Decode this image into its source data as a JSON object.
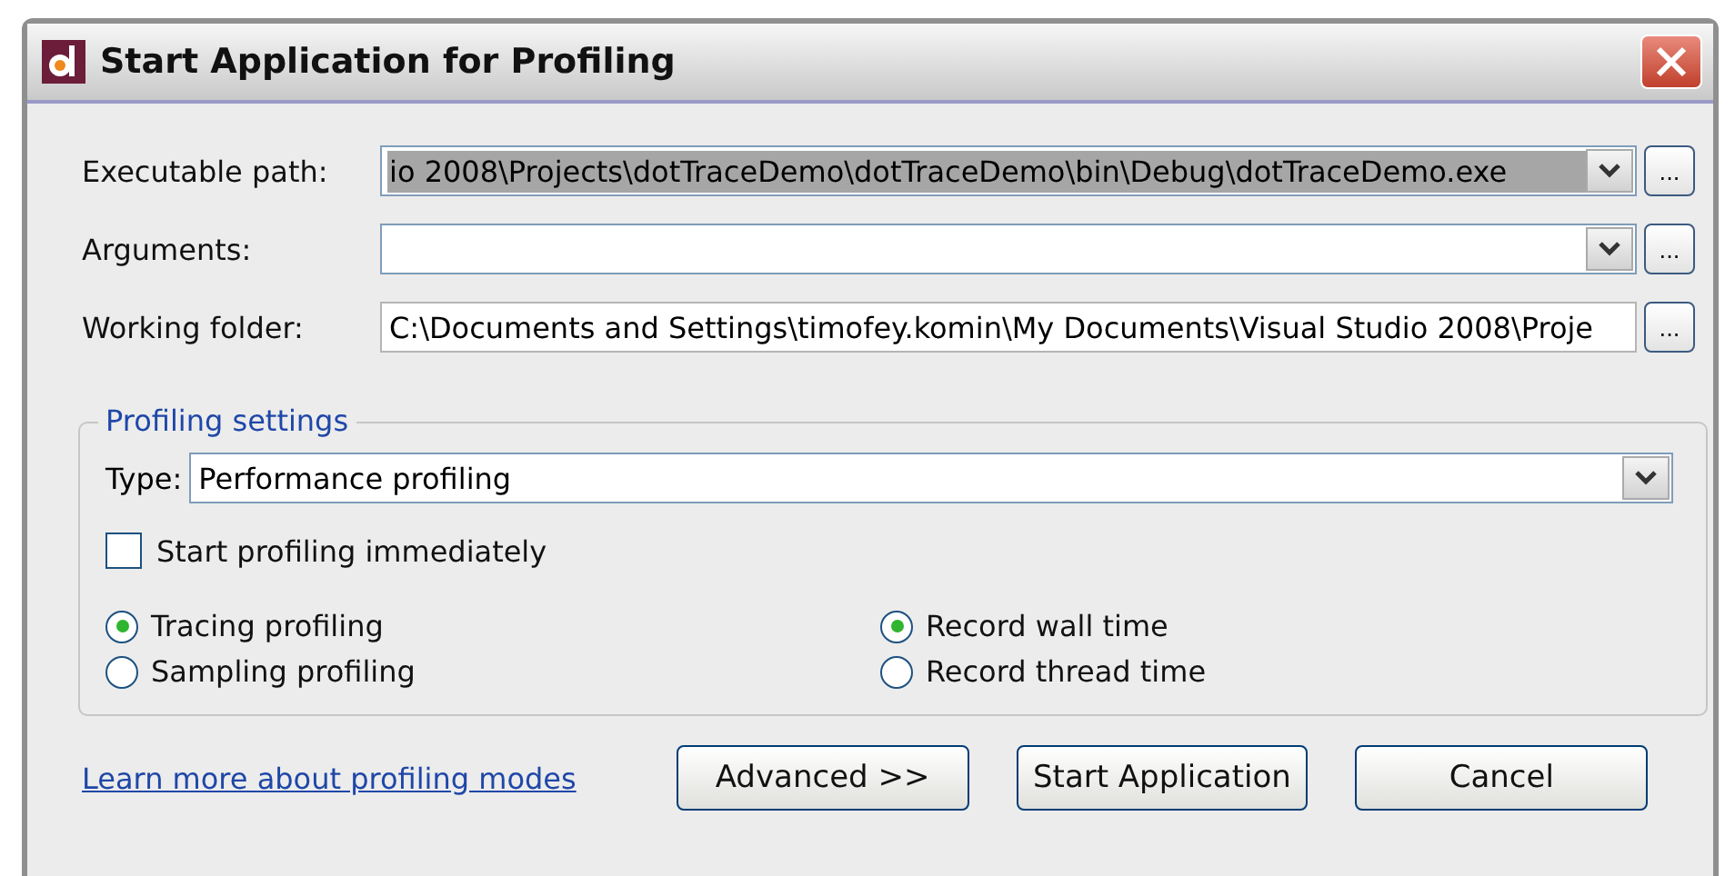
{
  "window": {
    "title": "Start Application for Profiling"
  },
  "fields": [
    {
      "label": "Executable path:",
      "value": "io 2008\\Projects\\dotTraceDemo\\dotTraceDemo\\bin\\Debug\\dotTraceDemo.exe",
      "text_selected": true,
      "dropdown": true
    },
    {
      "label": "Arguments:",
      "text_selected": false,
      "dropdown": true
    },
    {
      "label": "Working folder:",
      "value": "C:\\Documents and Settings\\timofey.komin\\My Documents\\Visual Studio 2008\\Proje",
      "text_selected": false,
      "dropdown": false
    }
  ],
  "browse_button": "...",
  "profiling_settings": {
    "title": "Profiling settings",
    "type_label": "Type:",
    "type_value": "Performance profiling",
    "start_immediately": {
      "label": "Start profiling immediately",
      "checked": false
    },
    "profiling_modes": [
      {
        "label": "Tracing profiling",
        "selected": true
      },
      {
        "label": "Sampling profiling",
        "selected": false
      }
    ],
    "time_modes": [
      {
        "label": "Record wall time",
        "selected": true
      },
      {
        "label": "Record thread time",
        "selected": false
      }
    ]
  },
  "link": "Learn more about profiling modes",
  "buttons": [
    "Advanced >>",
    "Start Application",
    "Cancel"
  ]
}
